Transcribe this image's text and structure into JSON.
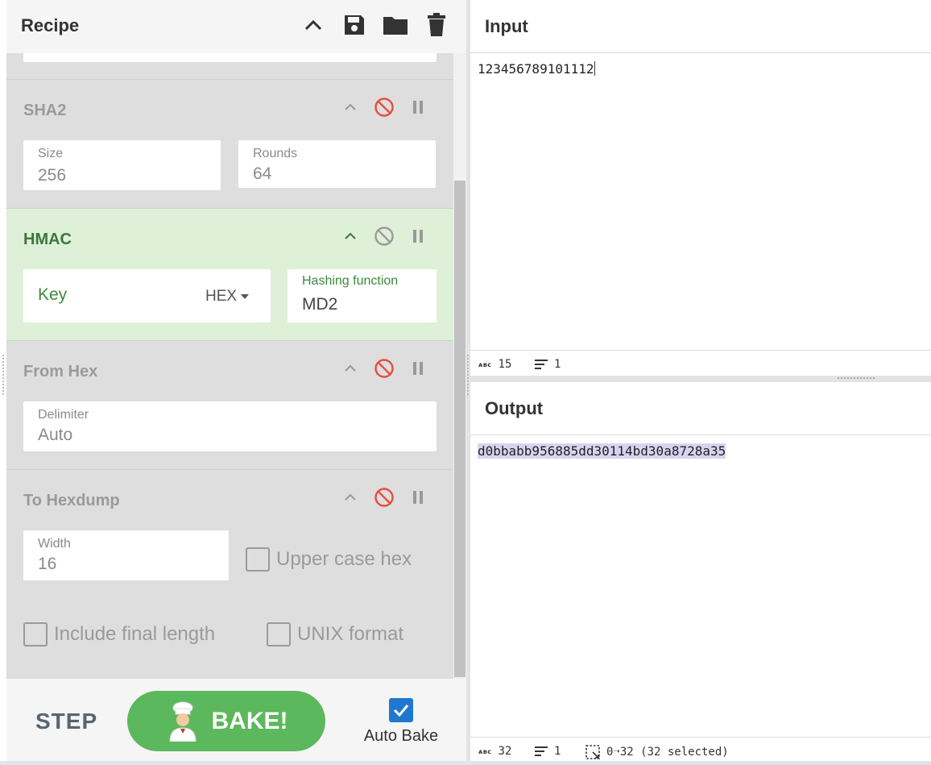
{
  "recipe": {
    "title": "Recipe",
    "operations": [
      {
        "name": "SHA2",
        "fields": [
          {
            "label": "Size",
            "value": "256"
          },
          {
            "label": "Rounds",
            "value": "64"
          }
        ]
      },
      {
        "name": "HMAC",
        "key_label": "Key",
        "key_format": "HEX",
        "hash_label": "Hashing function",
        "hash_value": "MD2"
      },
      {
        "name": "From Hex",
        "fields": [
          {
            "label": "Delimiter",
            "value": "Auto"
          }
        ]
      },
      {
        "name": "To Hexdump",
        "fields": [
          {
            "label": "Width",
            "value": "16"
          }
        ],
        "checkboxes": [
          {
            "label": "Upper case hex",
            "checked": false
          },
          {
            "label": "Include final length",
            "checked": false
          },
          {
            "label": "UNIX format",
            "checked": false
          }
        ]
      }
    ]
  },
  "controls": {
    "step_label": "STEP",
    "bake_label": "BAKE!",
    "autobake_label": "Auto Bake",
    "autobake_checked": true
  },
  "input": {
    "title": "Input",
    "text": "123456789101112",
    "status": {
      "length": "15",
      "lines": "1"
    }
  },
  "output": {
    "title": "Output",
    "text": "d0bbabb956885dd30114bd30a8728a35",
    "status": {
      "length": "32",
      "lines": "1",
      "selection": "0➝32 (32 selected)"
    }
  },
  "icons": {
    "header": [
      "chevron-up-icon",
      "save-icon",
      "folder-icon",
      "trash-icon"
    ],
    "op_controls": [
      "chevron-up-icon",
      "disable-icon",
      "pause-icon"
    ]
  },
  "colors": {
    "bake_green": "#5cb85c",
    "active_op_bg": "#dff0d8",
    "disable_red": "#e74c3c",
    "autobake_blue": "#1f77d0",
    "selection_purple": "#d7d4f0"
  }
}
